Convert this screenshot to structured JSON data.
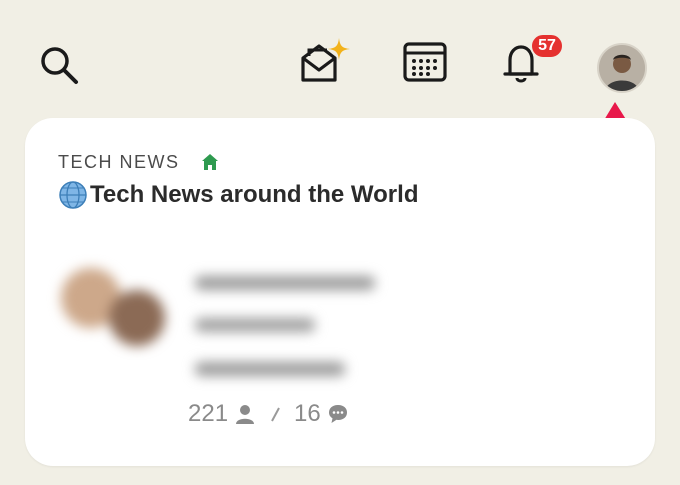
{
  "topbar": {
    "icons": [
      "search-icon",
      "invite-envelope-icon",
      "calendar-icon",
      "bell-icon"
    ],
    "notifications_count": "57",
    "accent_color": "#e5312f"
  },
  "card": {
    "club_name": "TECH NEWS",
    "room_title": "Tech News around the World",
    "listeners_count": "221",
    "speakers_count": "16",
    "home_color": "#2e9a4f"
  }
}
